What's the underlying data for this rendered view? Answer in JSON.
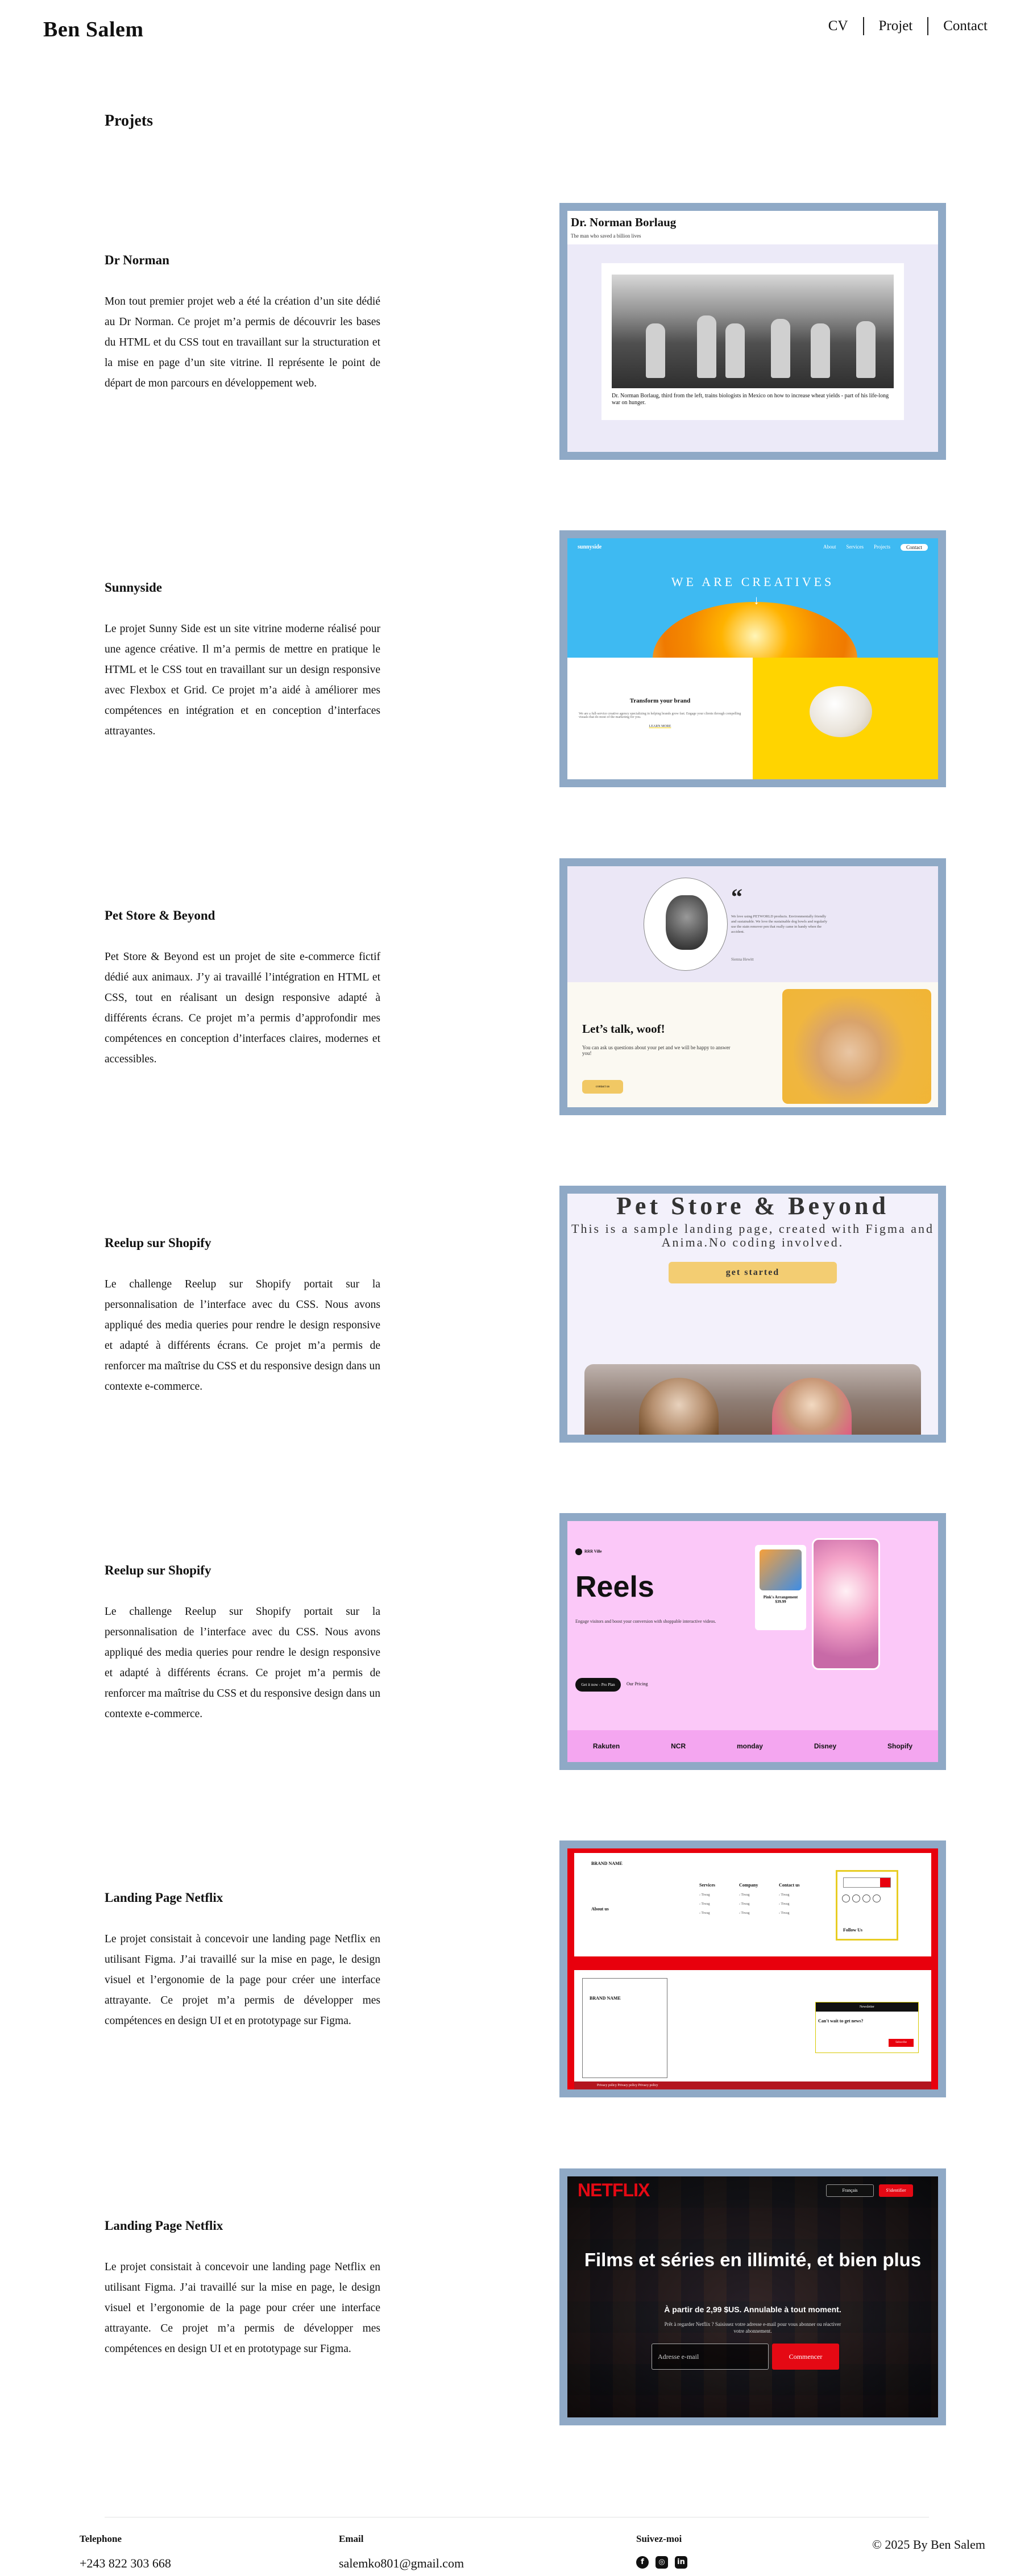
{
  "header": {
    "brand": "Ben Salem",
    "nav": [
      "CV",
      "Projet",
      "Contact"
    ]
  },
  "page_title": "Projets",
  "projects": [
    {
      "title": "Dr Norman",
      "description": "Mon tout premier projet web a été la création d’un site dédié au Dr Norman. Ce projet m’a permis de découvrir les bases du HTML et du CSS tout en travaillant sur la structuration et la mise en page d’un site vitrine. Il représente le point de départ de mon parcours en développement web.",
      "preview": {
        "title": "Dr. Norman Borlaug",
        "subtitle": "The man who saved a billion lives",
        "caption": "Dr. Norman Borlaug, third from the left, trains biologists in Mexico on how to increase wheat yields - part of his life-long war on hunger."
      }
    },
    {
      "title": "Sunnyside",
      "description": "Le projet Sunny Side est un site vitrine moderne réalisé pour une agence créative. Il m’a permis de mettre en pratique le HTML et le CSS tout en travaillant sur un design responsive avec Flexbox et Grid. Ce projet m’a aidé à améliorer mes compétences en intégration et en conception d’interfaces attrayantes.",
      "preview": {
        "logo": "sunnyside",
        "nav": [
          "About",
          "Services",
          "Projects",
          "Contact"
        ],
        "hero": "WE ARE CREATIVES",
        "block_title": "Transform your brand",
        "block_text": "We are a full-service creative agency specializing in helping brands grow fast. Engage your clients through compelling visuals that do most of the marketing for you.",
        "block_link": "LEARN MORE"
      }
    },
    {
      "title": "Pet Store & Beyond",
      "description": "Pet Store & Beyond est un projet de site e-commerce fictif dédié aux animaux. J’y ai travaillé l’intégration en HTML et CSS, tout en réalisant un design responsive adapté à différents écrans. Ce projet m’a permis d’approfondir mes compétences en conception d’interfaces claires, modernes et accessibles.",
      "preview": {
        "quote_mark": "“",
        "quote": "We love using PETWORLD products. Environmentally friendly and sustainable. We love the sustainable dog bowls and regularly use the stain remover pen that really came in handy when the accident.",
        "quote_author": "Sienna Hewitt",
        "cta_title": "Let’s talk, woof!",
        "cta_text": "You can ask us questions about your pet and we will be happy to answer you!",
        "cta_button": "contact us"
      }
    },
    {
      "title": "Reelup sur Shopify",
      "description": "Le challenge Reelup sur Shopify portait sur la personnalisation de l’interface avec du CSS. Nous avons appliqué des media queries pour rendre le design responsive et adapté à différents écrans. Ce projet m’a permis de renforcer ma maîtrise du CSS et du responsive design dans un contexte e-commerce.",
      "preview": {
        "title": "Pet Store & Beyond",
        "subtitle": "This is a sample landing page, created with Figma and Anima.No coding involved.",
        "button": "get started"
      }
    },
    {
      "title": "Reelup sur Shopify",
      "description": "Le challenge Reelup sur Shopify portait sur la personnalisation de l’interface avec du CSS. Nous avons appliqué des media queries pour rendre le design responsive et adapté à différents écrans. Ce projet m’a permis de renforcer ma maîtrise du CSS et du responsive design dans un contexte e-commerce.",
      "preview": {
        "brand": "RRR Ville",
        "headline": "Reels",
        "text": "Engage visitors and boost your conversion with shoppable interactive videos.",
        "button": "Get it now - Pro Plan",
        "button2": "Our Pricing",
        "product": "Pink's Arrangement",
        "price": "$39.99",
        "partners": [
          "Rakuten",
          "NCR",
          "monday",
          "Disney",
          "Shopify"
        ]
      }
    },
    {
      "title": "Landing Page Netflix",
      "description": "Le projet consistait à concevoir une landing page Netflix en utilisant Figma. J’ai travaillé sur la mise en page, le design visuel et l’ergonomie de la page pour créer une interface attrayante. Ce projet m’a permis de développer mes compétences en design UI et en prototypage sur Figma.",
      "preview": {
        "brand": "BRAND NAME",
        "about": "About us",
        "columns": [
          "Services",
          "Company",
          "Contact us"
        ],
        "follow": "Follow Us",
        "newsletter": "Newsletter",
        "newsletter_q": "Can't wait to get news?",
        "subscribe": "Subscribe",
        "footer": "Privacy policy   Privacy policy   Privacy policy"
      }
    },
    {
      "title": "Landing Page Netflix",
      "description": "Le projet consistait à concevoir une landing page Netflix en utilisant Figma. J’ai travaillé sur la mise en page, le design visuel et l’ergonomie de la page pour créer une interface attrayante. Ce projet m’a permis de développer mes compétences en design UI et en prototypage sur Figma.",
      "preview": {
        "logo": "NETFLIX",
        "lang": "Français",
        "signin": "S'identifier",
        "headline": "Films et séries en illimité, et bien plus",
        "sub": "À partir de 2,99 $US. Annulable à tout moment.",
        "text": "Prêt à regarder Netflix ? Saisissez votre adresse e-mail pour vous abonner ou réactiver votre abonnement.",
        "email_placeholder": "Adresse e-mail",
        "cta": "Commencer"
      }
    }
  ],
  "footer": {
    "phone_label": "Telephone",
    "phone": "+243 822 303 668",
    "email_label": "Email",
    "email": "salemko801@gmail.com",
    "social_label": "Suivez-moi",
    "social_icons": [
      "facebook-icon",
      "instagram-icon",
      "linkedin-icon"
    ],
    "copyright": "© 2025 By Ben Salem"
  }
}
